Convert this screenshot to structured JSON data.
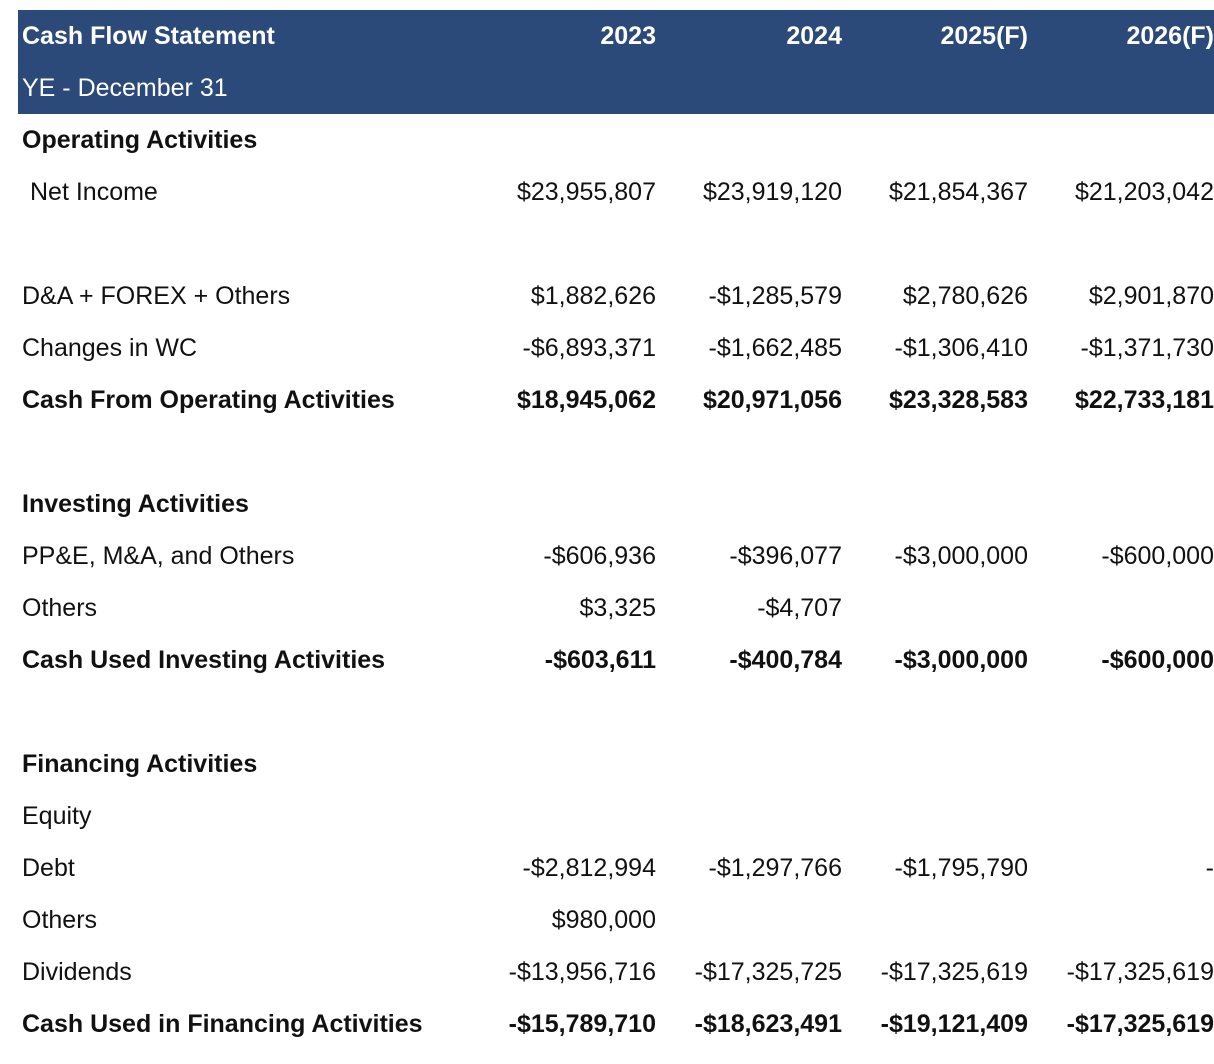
{
  "header": {
    "title": "Cash Flow Statement",
    "subtitle": "YE - December 31",
    "years": [
      "2023",
      "2024",
      "2025(F)",
      "2026(F)"
    ]
  },
  "rows": [
    {
      "label": "Operating Activities",
      "values": [
        "",
        "",
        "",
        ""
      ],
      "style": "section"
    },
    {
      "label": "Net Income",
      "values": [
        "$23,955,807",
        "$23,919,120",
        "$21,854,367",
        "$21,203,042"
      ],
      "style": "indent"
    },
    {
      "label": "",
      "values": [
        "",
        "",
        "",
        ""
      ],
      "style": "blank"
    },
    {
      "label": "D&A + FOREX + Others",
      "values": [
        "$1,882,626",
        "-$1,285,579",
        "$2,780,626",
        "$2,901,870"
      ],
      "style": "normal"
    },
    {
      "label": "Changes in WC",
      "values": [
        "-$6,893,371",
        "-$1,662,485",
        "-$1,306,410",
        "-$1,371,730"
      ],
      "style": "normal"
    },
    {
      "label": "Cash From Operating Activities",
      "values": [
        "$18,945,062",
        "$20,971,056",
        "$23,328,583",
        "$22,733,181"
      ],
      "style": "total"
    },
    {
      "label": "",
      "values": [
        "",
        "",
        "",
        ""
      ],
      "style": "blank"
    },
    {
      "label": "Investing Activities",
      "values": [
        "",
        "",
        "",
        ""
      ],
      "style": "section"
    },
    {
      "label": "PP&E, M&A, and Others",
      "values": [
        "-$606,936",
        "-$396,077",
        "-$3,000,000",
        "-$600,000"
      ],
      "style": "normal"
    },
    {
      "label": "Others",
      "values": [
        "$3,325",
        "-$4,707",
        "",
        ""
      ],
      "style": "normal"
    },
    {
      "label": "Cash Used Investing Activities",
      "values": [
        "-$603,611",
        "-$400,784",
        "-$3,000,000",
        "-$600,000"
      ],
      "style": "total"
    },
    {
      "label": "",
      "values": [
        "",
        "",
        "",
        ""
      ],
      "style": "blank"
    },
    {
      "label": "Financing Activities",
      "values": [
        "",
        "",
        "",
        ""
      ],
      "style": "section"
    },
    {
      "label": "Equity",
      "values": [
        "",
        "",
        "",
        ""
      ],
      "style": "normal"
    },
    {
      "label": "Debt",
      "values": [
        "-$2,812,994",
        "-$1,297,766",
        "-$1,795,790",
        "-"
      ],
      "style": "normal"
    },
    {
      "label": "Others",
      "values": [
        "$980,000",
        "",
        "",
        ""
      ],
      "style": "normal"
    },
    {
      "label": "Dividends",
      "values": [
        "-$13,956,716",
        "-$17,325,725",
        "-$17,325,619",
        "-$17,325,619"
      ],
      "style": "normal"
    },
    {
      "label": "Cash Used in Financing Activities",
      "values": [
        "-$15,789,710",
        "-$18,623,491",
        "-$19,121,409",
        "-$17,325,619"
      ],
      "style": "total"
    }
  ]
}
